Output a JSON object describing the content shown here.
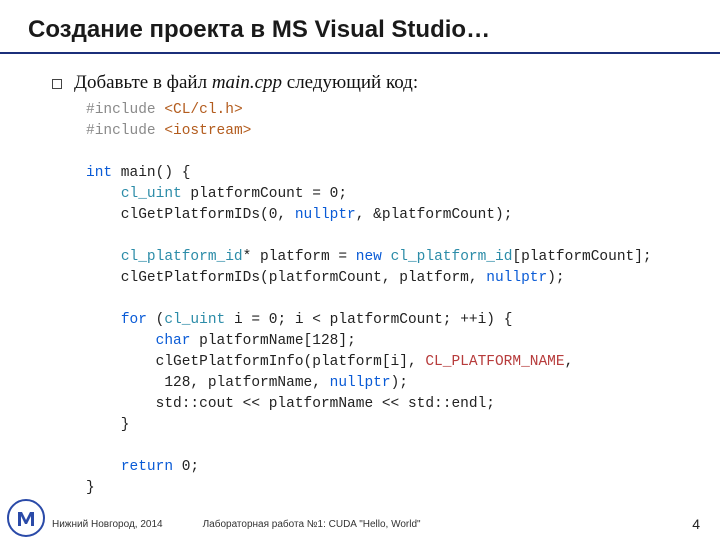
{
  "title": "Создание проекта в MS Visual Studio…",
  "bullet": {
    "prefix": "Добавьте в файл ",
    "filename": "main.cpp",
    "suffix": " следующий код:"
  },
  "code": {
    "inc1_kw": "#include",
    "inc1_path": "<CL/cl.h>",
    "inc2_kw": "#include",
    "inc2_path": "<iostream>",
    "l1_int": "int",
    "l1_rest": " main() {",
    "l2_ty": "cl_uint",
    "l2_rest": " platformCount = 0;",
    "l3": "    clGetPlatformIDs(0, ",
    "l3_null": "nullptr",
    "l3_end": ", &platformCount);",
    "l4_ty": "cl_platform_id",
    "l4_mid": "* platform = ",
    "l4_new": "new",
    "l4_sp": " ",
    "l4_ty2": "cl_platform_id",
    "l4_end": "[platformCount];",
    "l5_a": "    clGetPlatformIDs(platformCount, platform, ",
    "l5_null": "nullptr",
    "l5_b": ");",
    "l6_for": "for",
    "l6_a": " (",
    "l6_ty": "cl_uint",
    "l6_b": " i = 0; i < platformCount; ++i) {",
    "l7_char": "char",
    "l7_rest": " platformName[128];",
    "l8_a": "        clGetPlatformInfo(platform[i], ",
    "l8_macro": "CL_PLATFORM_NAME",
    "l8_b": ",",
    "l9_a": "         128, platformName, ",
    "l9_null": "nullptr",
    "l9_b": ");",
    "l10": "        std::cout << platformName << std::endl;",
    "l11": "    }",
    "l12_ret": "return",
    "l12_rest": " 0;",
    "l13": "}"
  },
  "footer": {
    "left": "Нижний Новгород, 2014",
    "mid": "Лабораторная работа №1: CUDA \"Hello, World\"",
    "page": "4"
  }
}
